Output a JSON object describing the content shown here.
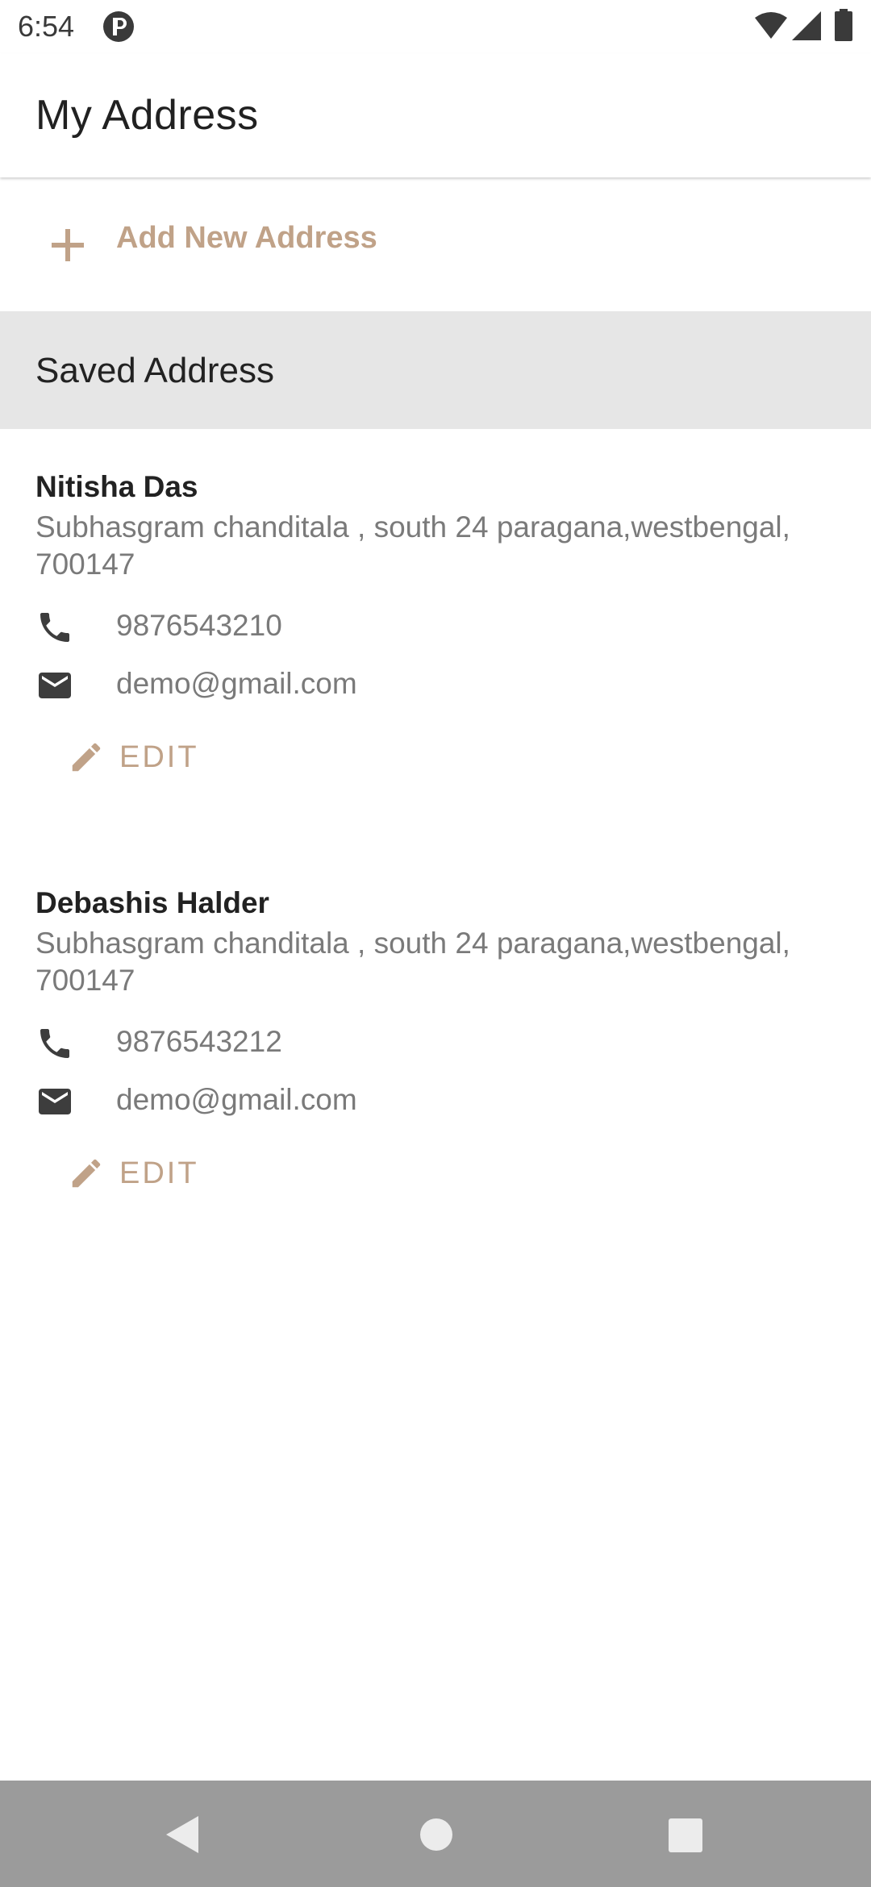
{
  "status_bar": {
    "time": "6:54"
  },
  "app_bar": {
    "title": "My Address"
  },
  "add_address": {
    "label": "Add New Address"
  },
  "saved_header": {
    "label": "Saved Address"
  },
  "addresses": [
    {
      "name": "Nitisha Das",
      "address": "Subhasgram chanditala , south 24 paragana,westbengal, 700147",
      "phone": "9876543210",
      "email": "demo@gmail.com",
      "edit_label": "EDIT"
    },
    {
      "name": "Debashis Halder",
      "address": "Subhasgram chanditala , south 24 paragana,westbengal, 700147",
      "phone": "9876543212",
      "email": "demo@gmail.com",
      "edit_label": "EDIT"
    }
  ],
  "colors": {
    "accent": "#c0a288",
    "section_bg": "#e6e6e6",
    "nav_bg": "#9b9b9b"
  },
  "icons": [
    "p-app-icon",
    "wifi-icon",
    "signal-icon",
    "battery-icon",
    "plus-icon",
    "phone-icon",
    "mail-icon",
    "pencil-icon",
    "back-icon",
    "home-icon",
    "recents-icon"
  ]
}
